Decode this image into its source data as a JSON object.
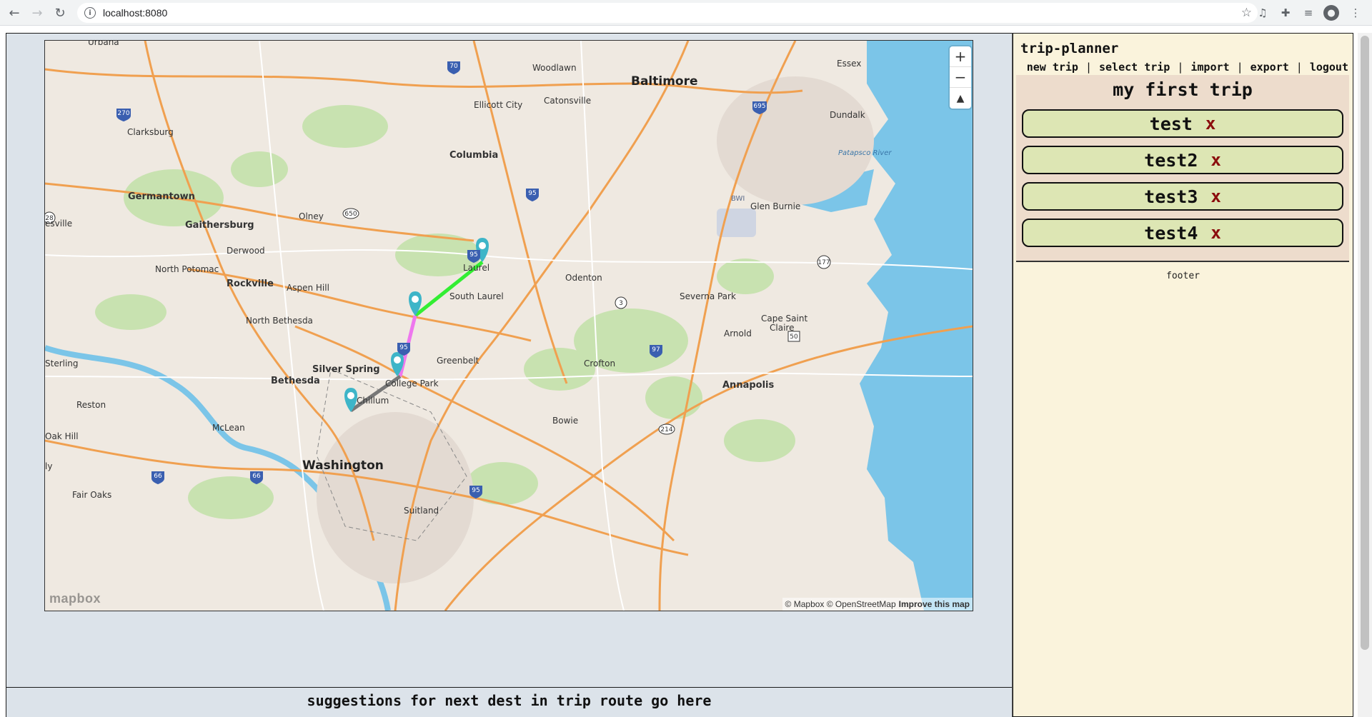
{
  "browser": {
    "url": "localhost:8080",
    "back_icon": "arrow-left-icon",
    "forward_icon": "arrow-right-icon",
    "reload_icon": "reload-icon"
  },
  "map": {
    "labels": {
      "urbana": "Urbana",
      "baltimore": "Baltimore",
      "woodlawn": "Woodlawn",
      "essex": "Essex",
      "ellicott_city": "Ellicott City",
      "catonsville": "Catonsville",
      "clarksburg": "Clarksburg",
      "dundalk": "Dundalk",
      "columbia": "Columbia",
      "patapsco_river": "Patapsco River",
      "germantown": "Germantown",
      "bwi": "BWI",
      "glen_burnie": "Glen Burnie",
      "olney": "Olney",
      "gaithersburg": "Gaithersburg",
      "sville": "esville",
      "derwood": "Derwood",
      "north_potomac": "North Potomac",
      "laurel": "Laurel",
      "odenton": "Odenton",
      "rockville": "Rockville",
      "aspen_hill": "Aspen Hill",
      "south_laurel": "South Laurel",
      "severna_park": "Severna Park",
      "north_bethesda": "North Bethesda",
      "cape_saint_claire_1": "Cape Saint",
      "cape_saint_claire_2": "Claire",
      "arnold": "Arnold",
      "greenbelt": "Greenbelt",
      "sterling": "Sterling",
      "silver_spring": "Silver Spring",
      "crofton": "Crofton",
      "bethesda": "Bethesda",
      "college_park": "College Park",
      "annapolis": "Annapolis",
      "reston": "Reston",
      "chillum": "Chillum",
      "mclean": "McLean",
      "bowie": "Bowie",
      "oak_hill": "Oak Hill",
      "washington": "Washington",
      "fair_oaks": "Fair Oaks",
      "suitland": "Suitland",
      "ly": "ly"
    },
    "shields": {
      "i70": "70",
      "i270": "270",
      "i695": "695",
      "i95a": "95",
      "i95b": "95",
      "i95c": "95",
      "r28": "28",
      "r650": "650",
      "r177": "177",
      "r3": "3",
      "i97": "97",
      "r50": "50",
      "r214": "214",
      "i66a": "66",
      "i66b": "66",
      "i95d": "95"
    },
    "attribution_osm": "© Mapbox © OpenStreetMap",
    "attribution_improve": "Improve this map",
    "logo": "mapbox",
    "zoom_in": "+",
    "zoom_out": "−",
    "compass": "▲",
    "route_colors": [
      "#33ee33",
      "#ee77ee",
      "#777777",
      "#777777"
    ],
    "marker_color": "#3eb5c8"
  },
  "suggestions_text": "suggestions for next dest in trip route go here",
  "sidebar": {
    "title": "trip-planner",
    "menu": [
      "new trip",
      "select trip",
      "import",
      "export",
      "logout"
    ],
    "separator": "|",
    "trip_name": "my first trip",
    "destinations": [
      "test",
      "test2",
      "test3",
      "test4"
    ],
    "remove_label": "x",
    "footer": "footer"
  }
}
